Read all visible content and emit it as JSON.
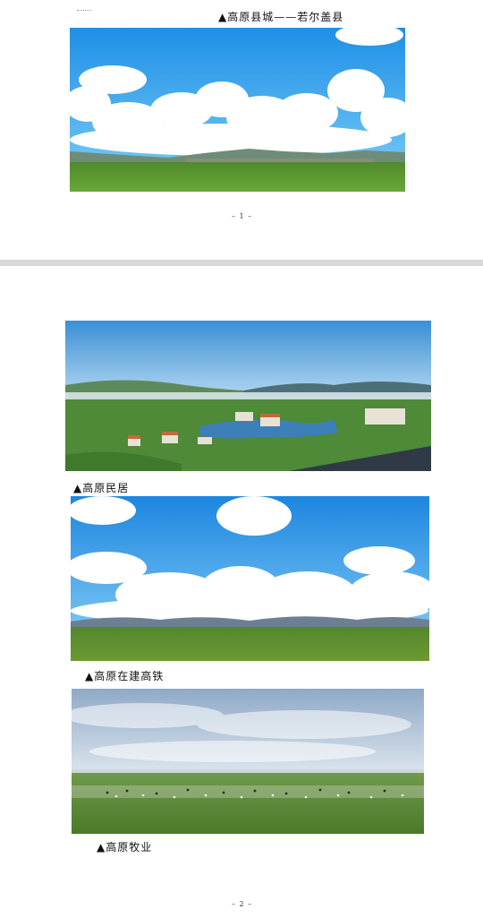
{
  "pages": [
    {
      "captions": [
        {
          "text": "▲高原县城——若尔盖县"
        }
      ],
      "page_number": "– 1 –"
    },
    {
      "captions": [
        {
          "text": "▲高原民居"
        },
        {
          "text": "▲高原在建高铁"
        },
        {
          "text": "▲高原牧业"
        }
      ],
      "page_number": "– 2 –"
    }
  ],
  "photos": [
    {
      "subject": "county town on grassland under blue sky"
    },
    {
      "subject": "river valley settlement with houses"
    },
    {
      "subject": "open grassland with cumulus clouds"
    },
    {
      "subject": "pasture with grazing herd under overcast sky"
    }
  ]
}
